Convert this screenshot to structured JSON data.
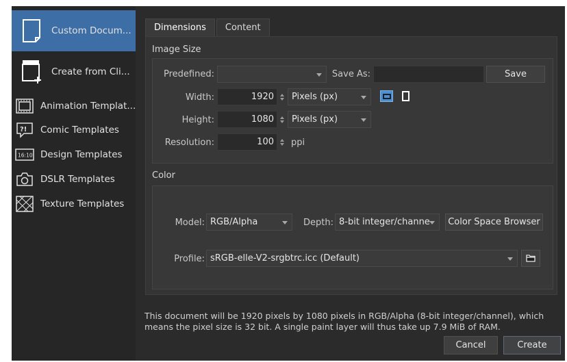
{
  "sidebar": {
    "items": [
      {
        "label": "Custom Docum...",
        "icon": "document-icon"
      },
      {
        "label": "Create from Cli...",
        "icon": "clipboard-add-icon"
      },
      {
        "label": "Animation Templat...",
        "icon": "film-icon"
      },
      {
        "label": "Comic Templates",
        "icon": "speech-bubble-icon"
      },
      {
        "label": "Design Templates",
        "icon": "aspect-ratio-icon"
      },
      {
        "label": "DSLR Templates",
        "icon": "camera-icon"
      },
      {
        "label": "Texture Templates",
        "icon": "texture-icon"
      }
    ]
  },
  "tabs": [
    {
      "label": "Dimensions"
    },
    {
      "label": "Content"
    }
  ],
  "image_size": {
    "title": "Image Size",
    "predefined_label": "Predefined:",
    "predefined_value": "",
    "save_as_label": "Save As:",
    "save_as_value": "",
    "save_label": "Save",
    "width_label": "Width:",
    "width_value": "1920",
    "width_unit": "Pixels (px)",
    "height_label": "Height:",
    "height_value": "1080",
    "height_unit": "Pixels (px)",
    "resolution_label": "Resolution:",
    "resolution_value": "100",
    "resolution_unit": "ppi"
  },
  "color": {
    "title": "Color",
    "model_label": "Model:",
    "model_value": "RGB/Alpha",
    "depth_label": "Depth:",
    "depth_value": "8-bit integer/channe",
    "browser_label": "Color Space Browser",
    "profile_label": "Profile:",
    "profile_value": "sRGB-elle-V2-srgbtrc.icc (Default)"
  },
  "footer": {
    "description": "This document will be 1920 pixels by 1080 pixels in RGB/Alpha (8-bit integer/channel), which means the pixel size is 32 bit. A single paint layer will thus take up 7.9 MiB of RAM.",
    "cancel_label": "Cancel",
    "create_label": "Create"
  },
  "colors": {
    "selected": "#3d6ea6",
    "orientation_active": "#4a8fd6"
  }
}
